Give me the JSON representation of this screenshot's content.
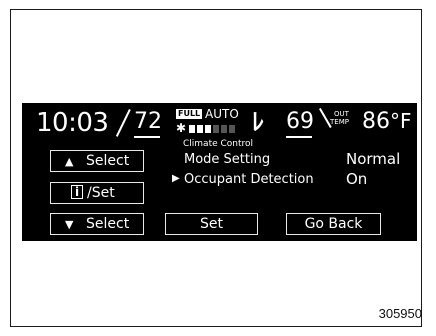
{
  "status": {
    "clock": "10:03",
    "driver_temp": "72",
    "fan_mode_badge": "FULL",
    "auto_label": "AUTO",
    "fan_level": 0.4,
    "passenger_temp": "69",
    "out_temp_label_line1": "OUT",
    "out_temp_label_line2": "TEMP",
    "out_temp": "86",
    "out_temp_unit": "°F"
  },
  "panel": {
    "title": "Climate Control",
    "rows": [
      {
        "label": "Mode Setting",
        "value": "Normal",
        "selected": false
      },
      {
        "label": "Occupant Detection",
        "value": "On",
        "selected": true
      }
    ],
    "selected_marker": "▶"
  },
  "buttons": {
    "select_up": {
      "arrow": "▲",
      "label": "Select"
    },
    "info_set": {
      "icon_glyph": "i",
      "label": "/Set"
    },
    "select_down": {
      "arrow": "▼",
      "label": "Select"
    },
    "set": "Set",
    "go_back": "Go Back"
  },
  "figure_id": "305950",
  "colors": {
    "screen_bg": "#000000",
    "text": "#ffffff"
  }
}
